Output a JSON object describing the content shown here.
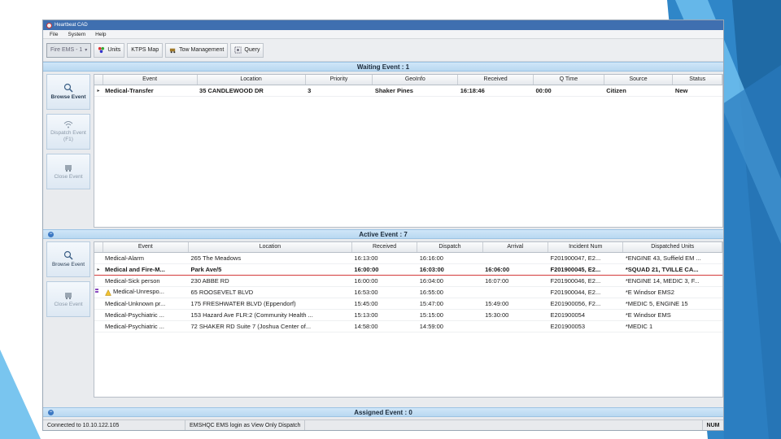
{
  "window": {
    "title": "Heartbeat CAD"
  },
  "menu": {
    "items": [
      "File",
      "System",
      "Help"
    ]
  },
  "toolbar": {
    "agency_select": "Fire EMS - 1",
    "units_label": "Units",
    "map_label": "KTPS Map",
    "tow_label": "Tow Management",
    "query_label": "Query"
  },
  "waiting": {
    "header": "Waiting Event : 1",
    "side": {
      "browse": "Browse Event",
      "dispatch": "Dispatch Event (F1)",
      "close": "Close Event"
    },
    "columns": [
      "Event",
      "Location",
      "Priority",
      "GeoInfo",
      "Received",
      "Q Time",
      "Source",
      "Status"
    ],
    "rows": [
      {
        "event": "Medical-Transfer",
        "location": "35 CANDLEWOOD DR",
        "priority": "3",
        "geoinfo": "Shaker Pines",
        "received": "16:18:46",
        "qtime": "00:00",
        "source": "Citizen",
        "status": "New"
      }
    ]
  },
  "active": {
    "header": "Active Event : 7",
    "side": {
      "browse": "Browse Event",
      "close": "Close Event"
    },
    "columns": [
      "Event",
      "Location",
      "Received",
      "Dispatch",
      "Arrival",
      "Incident Num",
      "Dispatched Units"
    ],
    "rows": [
      {
        "event": "Medical-Alarm",
        "location": "265 The Meadows",
        "received": "16:13:00",
        "dispatch": "16:16:00",
        "arrival": "",
        "incident": "F201900047, E2...",
        "units": "*ENGINE 43, Suffield EM ...",
        "style": "normal"
      },
      {
        "event": "Medical and Fire-M...",
        "location": "Park Ave/5",
        "received": "16:00:00",
        "dispatch": "16:03:00",
        "arrival": "16:06:00",
        "incident": "F201900045, E2...",
        "units": "*SQUAD 21, TVILLE CA...",
        "style": "selected"
      },
      {
        "event": "Medical-Sick person",
        "location": "230 ABBE RD",
        "received": "16:00:00",
        "dispatch": "16:04:00",
        "arrival": "16:07:00",
        "incident": "F201900046, E2...",
        "units": "*ENGINE 14, MEDIC 3, F...",
        "style": "normal"
      },
      {
        "event": "Medical-Unrespo...",
        "location": "65 ROOSEVELT BLVD",
        "received": "16:53:00",
        "dispatch": "16:55:00",
        "arrival": "",
        "incident": "F201900044, E2...",
        "units": "*E Windsor EMS2",
        "style": "flag"
      },
      {
        "event": "Medical-Unknown pr...",
        "location": "175 FRESHWATER BLVD (Eppendorf)",
        "received": "15:45:00",
        "dispatch": "15:47:00",
        "arrival": "15:49:00",
        "incident": "E201900056, F2...",
        "units": "*MEDIC 5, ENGINE 15",
        "style": "normal"
      },
      {
        "event": "Medical-Psychiatric ...",
        "location": "153 Hazard Ave FLR:2 (Community Health ...",
        "received": "15:13:00",
        "dispatch": "15:15:00",
        "arrival": "15:30:00",
        "incident": "E201900054",
        "units": "*E Windsor EMS",
        "style": "normal"
      },
      {
        "event": "Medical-Psychiatric ...",
        "location": "72 SHAKER RD Suite 7 (Joshua Center of...",
        "received": "14:58:00",
        "dispatch": "14:59:00",
        "arrival": "",
        "incident": "E201900053",
        "units": "*MEDIC 1",
        "style": "normal"
      }
    ]
  },
  "assigned": {
    "header": "Assigned Event : 0"
  },
  "status": {
    "connection": "Connected to 10.10.122.105",
    "login": "EMSHQC EMS login as View Only Dispatch",
    "num": "NUM"
  },
  "colors": {
    "accent": "#3f6fb0",
    "section": "#b9d8f1",
    "selected_border": "#d43b3b",
    "deco_light": "#5bb3e6",
    "deco_dark": "#1f6aa5"
  }
}
